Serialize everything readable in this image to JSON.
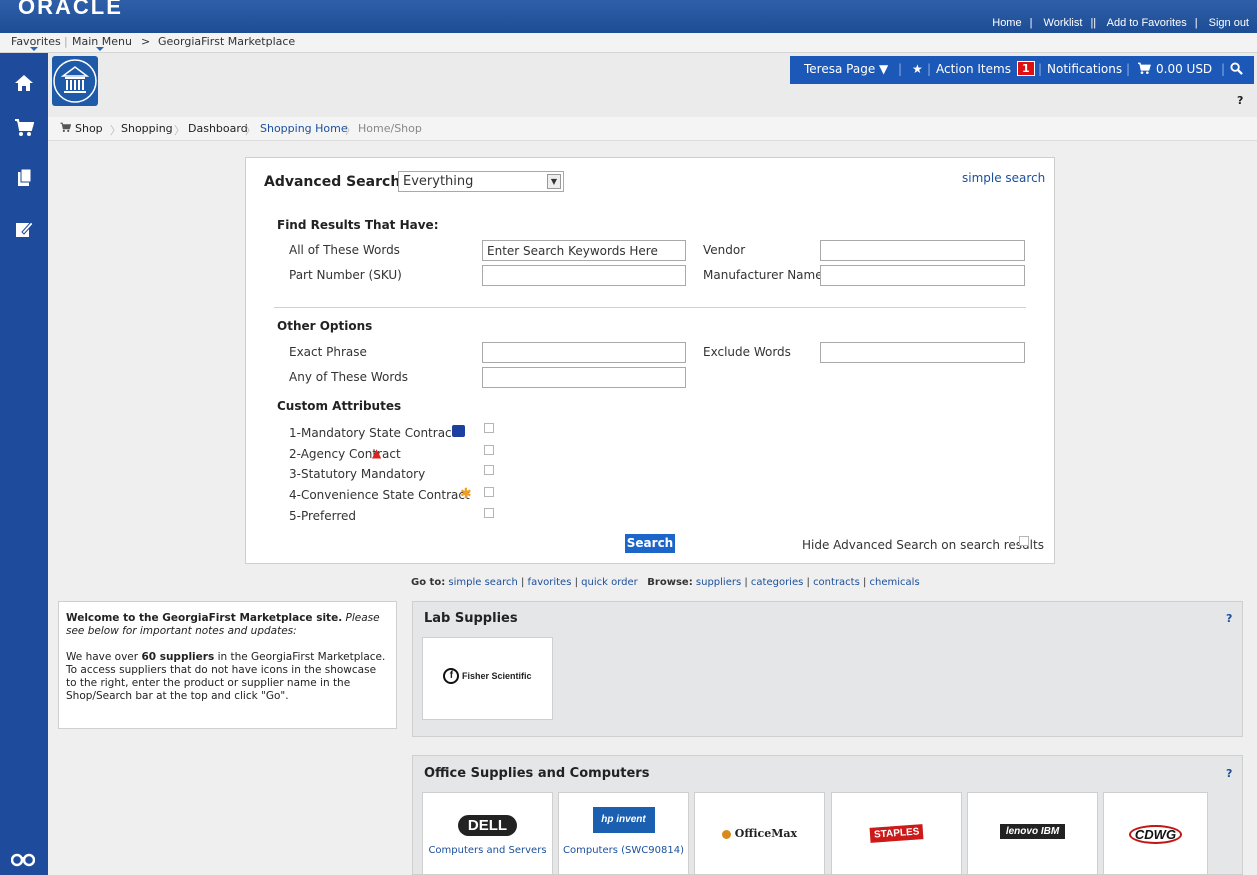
{
  "top_bar": {
    "logo": "ORACLE",
    "links": [
      "Home",
      "Worklist",
      "Add to Favorites",
      "Sign out"
    ]
  },
  "nav_bar": {
    "favorites": "Favorites",
    "main_menu": "Main Menu",
    "separator": ">",
    "current": "GeorgiaFirst Marketplace"
  },
  "user_bar": {
    "user": "Teresa Page ▼",
    "action_items": "Action Items",
    "action_count": "1",
    "notifications": "Notifications",
    "cart_amount": "0.00 USD"
  },
  "help_label": "?",
  "breadcrumb": [
    "Shop",
    "Shopping",
    "Dashboard",
    "Shopping Home",
    "Home/Shop"
  ],
  "search": {
    "title": "Advanced Search",
    "scope": "Everything",
    "simple_search_link": "simple search",
    "find_heading": "Find Results That Have:",
    "all_words_label": "All of These Words",
    "all_words_value": "Enter Search Keywords Here",
    "vendor_label": "Vendor",
    "part_number_label": "Part Number (SKU)",
    "manufacturer_label": "Manufacturer Name",
    "other_heading": "Other Options",
    "exact_phrase_label": "Exact Phrase",
    "exclude_words_label": "Exclude Words",
    "any_words_label": "Any of These Words",
    "custom_heading": "Custom Attributes",
    "attributes": [
      "1-Mandatory State Contract",
      "2-Agency Contract",
      "3-Statutory Mandatory",
      "4-Convenience State Contract",
      "5-Preferred"
    ],
    "search_button": "Search",
    "hide_advanced_label": "Hide Advanced Search on search results"
  },
  "goto": {
    "goto_label": "Go to:",
    "goto_links": [
      "simple search",
      "favorites",
      "quick order"
    ],
    "browse_label": "Browse:",
    "browse_links": [
      "suppliers",
      "categories",
      "contracts",
      "chemicals"
    ]
  },
  "welcome": {
    "title": "Welcome to the GeorgiaFirst Marketplace site.",
    "subtitle": "Please see below for important notes and updates:",
    "body_pre": "We have over",
    "body_bold": "60 suppliers",
    "body_post": "in the GeorgiaFirst Marketplace. To access suppliers that do not have icons in the showcase to the right, enter the product or supplier name in the Shop/Search bar at the top and click \"Go\"."
  },
  "lab_supplies": {
    "title": "Lab Supplies",
    "suppliers": [
      {
        "logo": "Fisher Scientific",
        "caption": ""
      }
    ]
  },
  "office_supplies": {
    "title": "Office Supplies and Computers",
    "suppliers": [
      {
        "logo": "DELL",
        "caption": "Computers and Servers"
      },
      {
        "logo": "hp invent",
        "caption": "Computers (SWC90814)"
      },
      {
        "logo": "OfficeMax",
        "caption": ""
      },
      {
        "logo": "STAPLES",
        "caption": ""
      },
      {
        "logo": "lenovo IBM",
        "caption": ""
      },
      {
        "logo": "CDWG",
        "caption": ""
      }
    ]
  }
}
